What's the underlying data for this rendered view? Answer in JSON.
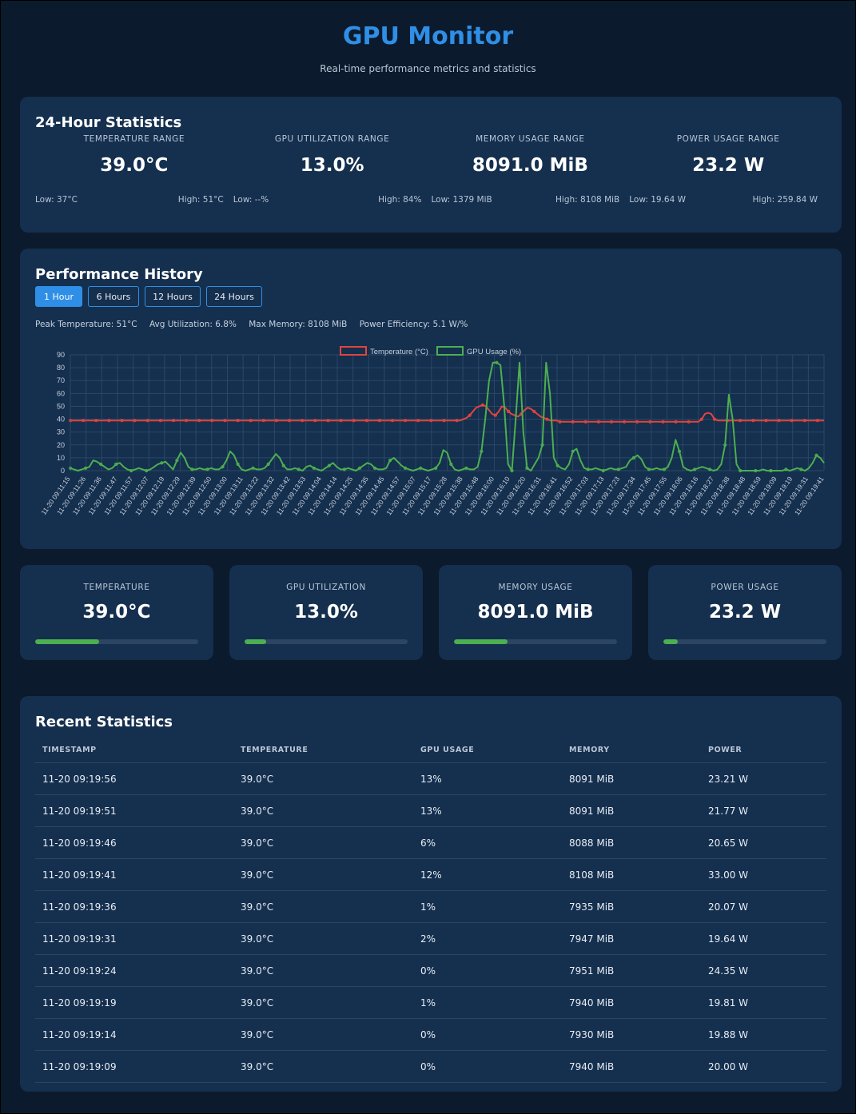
{
  "header": {
    "title": "GPU Monitor",
    "subtitle": "Real-time performance metrics and statistics"
  },
  "stats24": {
    "title": "24-Hour Statistics",
    "items": [
      {
        "label": "Temperature Range",
        "value": "39.0°C",
        "low": "Low: 37°C",
        "high": "High: 51°C"
      },
      {
        "label": "GPU Utilization Range",
        "value": "13.0%",
        "low": "Low: --%",
        "high": "High: 84%"
      },
      {
        "label": "Memory Usage Range",
        "value": "8091.0 MiB",
        "low": "Low: 1379 MiB",
        "high": "High: 8108 MiB"
      },
      {
        "label": "Power Usage Range",
        "value": "23.2 W",
        "low": "Low: 19.64 W",
        "high": "High: 259.84 W"
      }
    ]
  },
  "performance": {
    "title": "Performance History",
    "tabs": [
      "1 Hour",
      "6 Hours",
      "12 Hours",
      "24 Hours"
    ],
    "active_tab": "1 Hour",
    "summary": {
      "peak_temperature": "Peak Temperature: 51°C",
      "avg_utilization": "Avg Utilization: 6.8%",
      "max_memory": "Max Memory: 8108 MiB",
      "power_efficiency": "Power Efficiency: 5.1 W/%"
    }
  },
  "chart_data": {
    "type": "line",
    "ylim": [
      0,
      90
    ],
    "yticks": [
      0,
      10,
      20,
      30,
      40,
      50,
      60,
      70,
      80,
      90
    ],
    "grid": true,
    "legend_position": "top",
    "x_labels": [
      "11-20 09:11:15",
      "11-20 09:11:26",
      "11-20 09:11:36",
      "11-20 09:11:47",
      "11-20 09:11:57",
      "11-20 09:12:07",
      "11-20 09:12:19",
      "11-20 09:12:29",
      "11-20 09:12:39",
      "11-20 09:12:50",
      "11-20 09:13:00",
      "11-20 09:13:11",
      "11-20 09:13:22",
      "11-20 09:13:32",
      "11-20 09:13:42",
      "11-20 09:13:53",
      "11-20 09:14:04",
      "11-20 09:14:14",
      "11-20 09:14:25",
      "11-20 09:14:35",
      "11-20 09:14:45",
      "11-20 09:14:57",
      "11-20 09:15:07",
      "11-20 09:15:17",
      "11-20 09:15:28",
      "11-20 09:15:38",
      "11-20 09:15:48",
      "11-20 09:16:00",
      "11-20 09:16:10",
      "11-20 09:16:20",
      "11-20 09:16:31",
      "11-20 09:16:41",
      "11-20 09:16:52",
      "11-20 09:17:03",
      "11-20 09:17:13",
      "11-20 09:17:23",
      "11-20 09:17:34",
      "11-20 09:17:45",
      "11-20 09:17:55",
      "11-20 09:18:06",
      "11-20 09:18:16",
      "11-20 09:18:27",
      "11-20 09:18:38",
      "11-20 09:18:48",
      "11-20 09:18:59",
      "11-20 09:19:09",
      "11-20 09:19:19",
      "11-20 09:19:31",
      "11-20 09:19:41"
    ],
    "series": [
      {
        "name": "Temperature (°C)",
        "color": "#e0453e",
        "values": [
          39,
          39,
          39,
          39,
          39,
          39,
          39,
          39,
          39,
          39,
          39,
          39,
          39,
          39,
          39,
          39,
          39,
          39,
          39,
          39,
          39,
          39,
          39,
          39,
          39,
          39,
          39,
          39,
          39,
          39,
          39,
          39,
          39,
          39,
          39,
          39,
          39,
          39,
          39,
          39,
          39,
          39,
          39,
          39,
          39,
          39,
          39,
          39,
          39,
          39,
          39,
          39,
          39,
          39,
          39,
          39,
          39,
          39,
          39,
          39,
          39,
          39,
          39,
          39,
          39,
          39,
          39,
          39,
          39,
          39,
          39,
          39,
          39,
          39,
          39,
          39,
          39,
          39,
          39,
          39,
          39,
          39,
          39,
          39,
          39,
          39,
          39,
          39,
          39,
          39,
          39,
          39,
          39,
          39,
          39,
          39,
          39,
          39,
          39,
          39,
          39,
          39,
          39,
          39,
          39,
          39,
          39,
          39,
          39,
          39,
          39,
          39,
          39,
          39,
          39,
          39,
          39,
          39,
          39,
          39,
          39,
          39,
          40,
          41,
          43,
          46,
          49,
          50,
          51,
          50,
          47,
          44,
          43,
          46,
          50,
          49,
          46,
          44,
          43,
          42,
          44,
          47,
          49,
          48,
          46,
          44,
          42,
          41,
          40,
          39,
          39,
          39,
          38,
          38,
          38,
          38,
          38,
          38,
          38,
          38,
          38,
          38,
          38,
          38,
          38,
          38,
          38,
          38,
          38,
          38,
          38,
          38,
          38,
          38,
          38,
          38,
          38,
          38,
          38,
          38,
          38,
          38,
          38,
          38,
          38,
          38,
          38,
          38,
          38,
          38,
          38,
          38,
          38,
          38,
          38,
          38,
          40,
          44,
          45,
          44,
          40,
          39,
          39,
          39,
          39,
          39,
          39,
          39,
          39,
          39,
          39,
          39,
          39,
          39,
          39,
          39,
          39,
          39,
          39,
          39,
          39,
          39,
          39,
          39,
          39,
          39,
          39,
          39,
          39,
          39,
          39,
          39,
          39,
          39,
          39
        ]
      },
      {
        "name": "GPU Usage (%)",
        "color": "#4caf50",
        "values": [
          2,
          1,
          0,
          1,
          2,
          3,
          8,
          7,
          5,
          3,
          1,
          2,
          5,
          6,
          3,
          1,
          0,
          1,
          2,
          1,
          0,
          1,
          3,
          5,
          6,
          7,
          4,
          1,
          8,
          14,
          10,
          3,
          1,
          1,
          2,
          1,
          1,
          2,
          1,
          1,
          3,
          8,
          15,
          12,
          5,
          1,
          0,
          1,
          2,
          1,
          1,
          2,
          5,
          9,
          13,
          10,
          4,
          1,
          1,
          2,
          1,
          0,
          3,
          4,
          2,
          1,
          0,
          2,
          4,
          6,
          3,
          1,
          1,
          2,
          1,
          0,
          2,
          4,
          6,
          5,
          2,
          1,
          1,
          2,
          8,
          10,
          7,
          4,
          2,
          1,
          0,
          1,
          2,
          1,
          0,
          1,
          2,
          6,
          16,
          14,
          5,
          1,
          0,
          1,
          2,
          1,
          1,
          3,
          15,
          40,
          70,
          84,
          84,
          82,
          50,
          5,
          0,
          40,
          84,
          30,
          2,
          0,
          5,
          10,
          20,
          84,
          60,
          10,
          4,
          2,
          1,
          5,
          15,
          17,
          8,
          2,
          1,
          1,
          2,
          1,
          0,
          1,
          2,
          1,
          1,
          2,
          3,
          8,
          10,
          12,
          9,
          3,
          1,
          1,
          2,
          1,
          1,
          3,
          10,
          24,
          15,
          3,
          1,
          0,
          1,
          2,
          3,
          2,
          1,
          0,
          1,
          5,
          20,
          59,
          40,
          5,
          0,
          0,
          0,
          0,
          0,
          0,
          1,
          0,
          0,
          0,
          0,
          0,
          1,
          0,
          1,
          2,
          1,
          0,
          2,
          6,
          12,
          10,
          6
        ]
      }
    ]
  },
  "metrics": [
    {
      "label": "Temperature",
      "value": "39.0°C",
      "fill": 0.39
    },
    {
      "label": "GPU Utilization",
      "value": "13.0%",
      "fill": 0.13
    },
    {
      "label": "Memory Usage",
      "value": "8091.0 MiB",
      "fill": 0.33
    },
    {
      "label": "Power Usage",
      "value": "23.2 W",
      "fill": 0.09
    }
  ],
  "recent": {
    "title": "Recent Statistics",
    "columns": [
      "Timestamp",
      "Temperature",
      "GPU Usage",
      "Memory",
      "Power"
    ],
    "rows": [
      [
        "11-20 09:19:56",
        "39.0°C",
        "13%",
        "8091 MiB",
        "23.21 W"
      ],
      [
        "11-20 09:19:51",
        "39.0°C",
        "13%",
        "8091 MiB",
        "21.77 W"
      ],
      [
        "11-20 09:19:46",
        "39.0°C",
        "6%",
        "8088 MiB",
        "20.65 W"
      ],
      [
        "11-20 09:19:41",
        "39.0°C",
        "12%",
        "8108 MiB",
        "33.00 W"
      ],
      [
        "11-20 09:19:36",
        "39.0°C",
        "1%",
        "7935 MiB",
        "20.07 W"
      ],
      [
        "11-20 09:19:31",
        "39.0°C",
        "2%",
        "7947 MiB",
        "19.64 W"
      ],
      [
        "11-20 09:19:24",
        "39.0°C",
        "0%",
        "7951 MiB",
        "24.35 W"
      ],
      [
        "11-20 09:19:19",
        "39.0°C",
        "1%",
        "7940 MiB",
        "19.81 W"
      ],
      [
        "11-20 09:19:14",
        "39.0°C",
        "0%",
        "7930 MiB",
        "19.88 W"
      ],
      [
        "11-20 09:19:09",
        "39.0°C",
        "0%",
        "7940 MiB",
        "20.00 W"
      ]
    ]
  }
}
